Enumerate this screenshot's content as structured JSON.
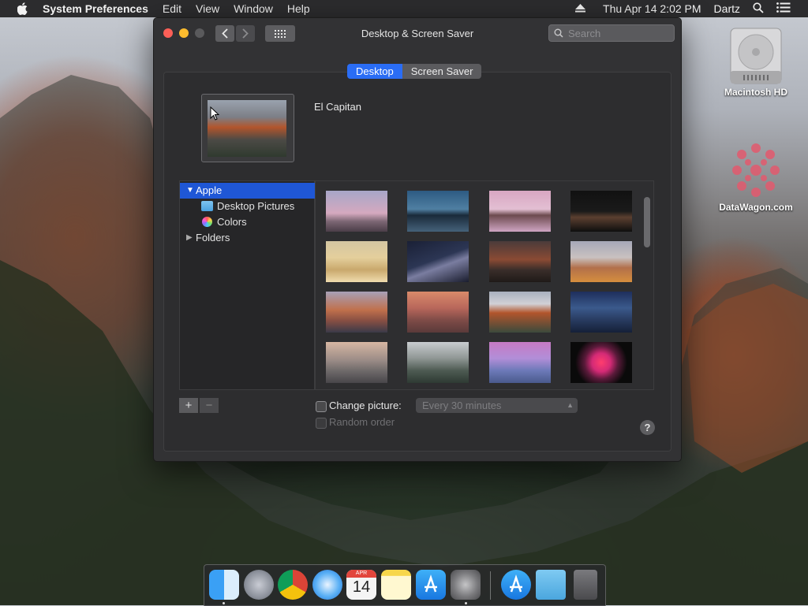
{
  "menubar": {
    "app_name": "System Preferences",
    "items": [
      "Edit",
      "View",
      "Window",
      "Help"
    ],
    "datetime": "Thu Apr 14  2:02 PM",
    "user": "Dartz"
  },
  "window": {
    "title": "Desktop & Screen Saver",
    "search_placeholder": "Search",
    "tabs": [
      {
        "label": "Desktop",
        "active": true
      },
      {
        "label": "Screen Saver",
        "active": false
      }
    ],
    "current_image_name": "El Capitan",
    "sources": [
      {
        "label": "Apple",
        "expanded": true,
        "selected": true
      },
      {
        "label": "Desktop Pictures",
        "selected": false
      },
      {
        "label": "Colors",
        "selected": false
      },
      {
        "label": "Folders",
        "expanded": false,
        "selected": false
      }
    ],
    "change_picture_label": "Change picture:",
    "change_picture_checked": false,
    "interval_value": "Every 30 minutes",
    "random_order_label": "Random order",
    "random_order_checked": false,
    "help_label": "?",
    "add_label": "+",
    "remove_label": "−"
  },
  "desktop_icons": [
    {
      "label": "Macintosh HD",
      "icon": "hard-drive-icon"
    },
    {
      "label": "DataWagon.com",
      "icon": "datawagon-logo-icon"
    }
  ],
  "dock_apps": [
    "Finder",
    "Launchpad",
    "Chrome",
    "Safari",
    "Calendar",
    "Notes",
    "App Store",
    "System Preferences",
    "App Store",
    "Downloads",
    "Trash"
  ],
  "calendar_icon": {
    "month": "APR",
    "day": "14"
  },
  "colors": {
    "accent": "#2a6df5",
    "selection": "#1f57d6",
    "close": "#fc5f57",
    "minimize": "#fdbc2e"
  }
}
